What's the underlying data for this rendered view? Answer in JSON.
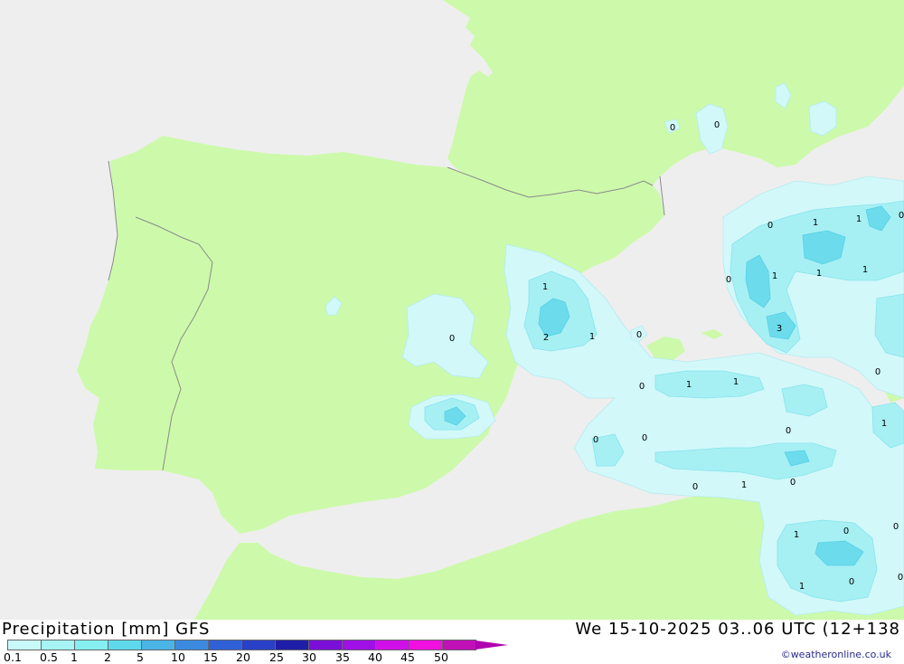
{
  "header": {
    "title": "Precipitation [mm] GFS",
    "datetime": "We 15-10-2025 03..06 UTC (12+138",
    "credit": "©weatheronline.co.uk"
  },
  "legend": {
    "colors": [
      "#c8fafa",
      "#a6f4f4",
      "#84eef0",
      "#5ed8ea",
      "#4bb4e6",
      "#3c8ae0",
      "#3060d6",
      "#2a40c8",
      "#1e1ea8",
      "#7a10d8",
      "#a010e6",
      "#d010e8",
      "#f010e0",
      "#c010b8"
    ],
    "arrow_color": "#b000b0",
    "tick_labels": [
      "0.1",
      "0.5",
      "1",
      "2",
      "5",
      "10",
      "15",
      "20",
      "25",
      "30",
      "35",
      "40",
      "45",
      "50"
    ]
  },
  "map": {
    "colors": {
      "sea": "#eeeeee",
      "land": "#ccfaaa",
      "border": "#8a8a8a",
      "precip_light": "#d2f8fa",
      "precip_mid": "#a6f0f4",
      "precip_heavy": "#6cdcec"
    },
    "contour_labels": [
      "0",
      "0",
      "0",
      "1",
      "2",
      "1",
      "0",
      "0",
      "1",
      "1",
      "0",
      "0",
      "0",
      "1",
      "0",
      "0",
      "0",
      "1",
      "1",
      "1",
      "0",
      "1",
      "3",
      "0",
      "1",
      "0",
      "1",
      "0",
      "1",
      "0",
      "0",
      "1",
      "0",
      "1",
      "0",
      "0",
      "1",
      "0",
      "0"
    ]
  }
}
